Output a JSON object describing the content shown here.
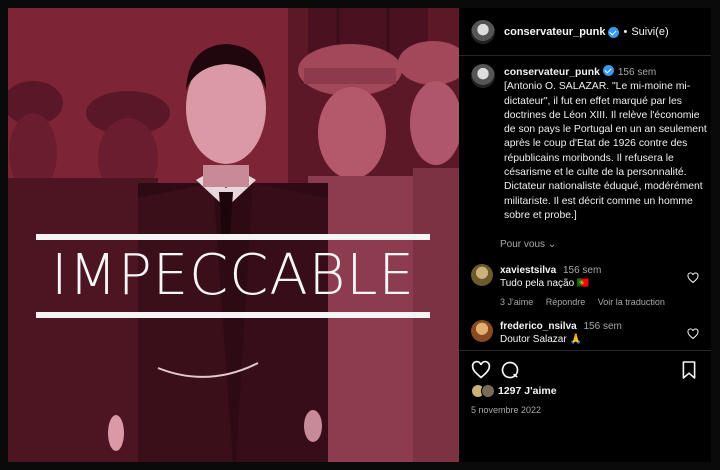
{
  "post": {
    "overlay_text": "IMPECCABLE"
  },
  "header": {
    "username": "conservateur_punk",
    "separator": "•",
    "follow_status": "Suivi(e)"
  },
  "caption": {
    "username": "conservateur_punk",
    "timestamp": "156 sem",
    "text": "[Antonio O. SALAZAR. \"Le mi-moine mi-dictateur\", il fut en effet marqué par les doctrines de Léon XIII. Il relève l'économie de son pays le Portugal en un an seulement après le coup d'Etat de 1926 contre des républicains moribonds. Il refusera le césarisme et le culte de la personnalité. Dictateur nationaliste éduqué, modérément militariste. Il est décrit comme un homme sobre et probe.]",
    "more_label": "Pour vous"
  },
  "comments": [
    {
      "username": "xaviestsilva",
      "timestamp": "156 sem",
      "text": "Tudo pela nação 🇵🇹",
      "likes": "3 J'aime",
      "reply": "Répondre",
      "translate": "Voir la traduction"
    },
    {
      "username": "frederico_nsilva",
      "timestamp": "156 sem",
      "text": "Doutor Salazar 🙏"
    }
  ],
  "footer": {
    "likes": "1297 J'aime",
    "date": "5 novembre 2022"
  },
  "colors": {
    "accent_verified": "#3897f0",
    "photo_tint": "#8a2a3c"
  }
}
